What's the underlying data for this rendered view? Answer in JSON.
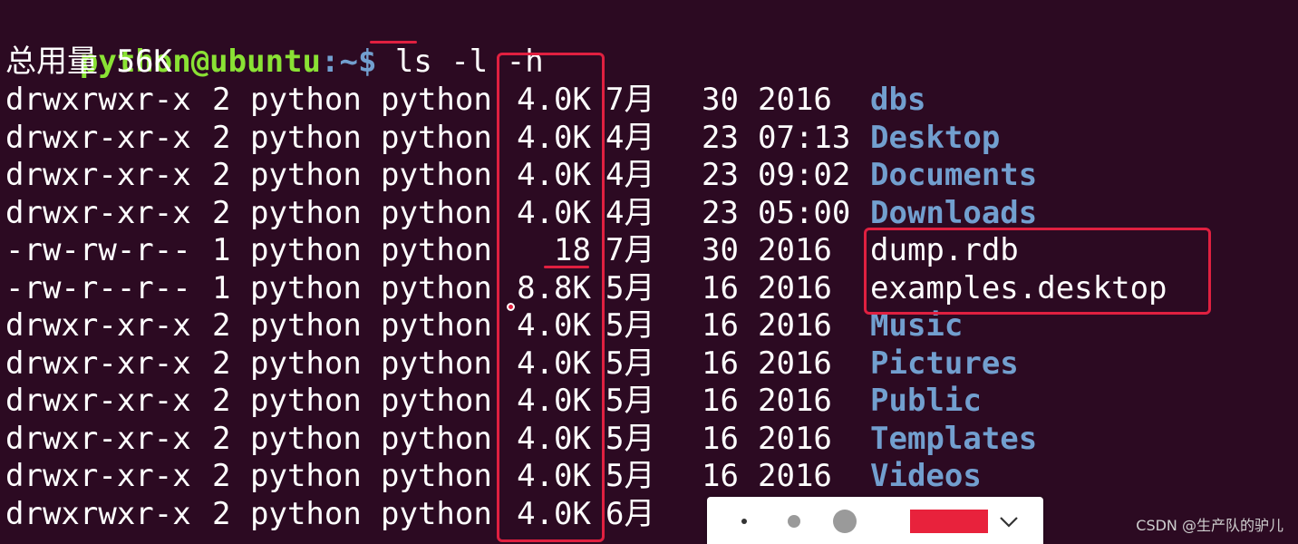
{
  "terminal": {
    "prompt_user": "python@ubuntu",
    "prompt_path": ":~$",
    "command_cmd": " ls ",
    "command_flag_l": "-l",
    "command_flag_h": " -h",
    "total_line": "总用量 56K",
    "rows": [
      {
        "perm": "drwxrwxr-x",
        "links": "2",
        "owner": "python",
        "group": "python",
        "size": "4.0K",
        "month": "7月",
        "day": "30",
        "time": "2016",
        "name": "dbs",
        "type": "dir"
      },
      {
        "perm": "drwxr-xr-x",
        "links": "2",
        "owner": "python",
        "group": "python",
        "size": "4.0K",
        "month": "4月",
        "day": "23",
        "time": "07:13",
        "name": "Desktop",
        "type": "dir"
      },
      {
        "perm": "drwxr-xr-x",
        "links": "2",
        "owner": "python",
        "group": "python",
        "size": "4.0K",
        "month": "4月",
        "day": "23",
        "time": "09:02",
        "name": "Documents",
        "type": "dir"
      },
      {
        "perm": "drwxr-xr-x",
        "links": "2",
        "owner": "python",
        "group": "python",
        "size": "4.0K",
        "month": "4月",
        "day": "23",
        "time": "05:00",
        "name": "Downloads",
        "type": "dir"
      },
      {
        "perm": "-rw-rw-r--",
        "links": "1",
        "owner": "python",
        "group": "python",
        "size": "18",
        "month": "7月",
        "day": "30",
        "time": "2016",
        "name": "dump.rdb",
        "type": "file"
      },
      {
        "perm": "-rw-r--r--",
        "links": "1",
        "owner": "python",
        "group": "python",
        "size": "8.8K",
        "month": "5月",
        "day": "16",
        "time": "2016",
        "name": "examples.desktop",
        "type": "file"
      },
      {
        "perm": "drwxr-xr-x",
        "links": "2",
        "owner": "python",
        "group": "python",
        "size": "4.0K",
        "month": "5月",
        "day": "16",
        "time": "2016",
        "name": "Music",
        "type": "dir"
      },
      {
        "perm": "drwxr-xr-x",
        "links": "2",
        "owner": "python",
        "group": "python",
        "size": "4.0K",
        "month": "5月",
        "day": "16",
        "time": "2016",
        "name": "Pictures",
        "type": "dir"
      },
      {
        "perm": "drwxr-xr-x",
        "links": "2",
        "owner": "python",
        "group": "python",
        "size": "4.0K",
        "month": "5月",
        "day": "16",
        "time": "2016",
        "name": "Public",
        "type": "dir"
      },
      {
        "perm": "drwxr-xr-x",
        "links": "2",
        "owner": "python",
        "group": "python",
        "size": "4.0K",
        "month": "5月",
        "day": "16",
        "time": "2016",
        "name": "Templates",
        "type": "dir"
      },
      {
        "perm": "drwxr-xr-x",
        "links": "2",
        "owner": "python",
        "group": "python",
        "size": "4.0K",
        "month": "5月",
        "day": "16",
        "time": "2016",
        "name": "Videos",
        "type": "dir"
      },
      {
        "perm": "drwxrwxr-x",
        "links": "2",
        "owner": "python",
        "group": "python",
        "size": "4.0K",
        "month": "6月",
        "day": "",
        "time": "",
        "name": "",
        "type": "dir"
      }
    ]
  },
  "annotation_toolbar": {
    "selected_color": "#e8223c",
    "dot_sizes": [
      "small",
      "medium",
      "large"
    ]
  },
  "watermark": "CSDN @生产队的驴儿",
  "colors": {
    "background": "#2c0a22",
    "prompt_green": "#8ae234",
    "directory_blue": "#729fcf",
    "annotation_red": "#e02040"
  }
}
